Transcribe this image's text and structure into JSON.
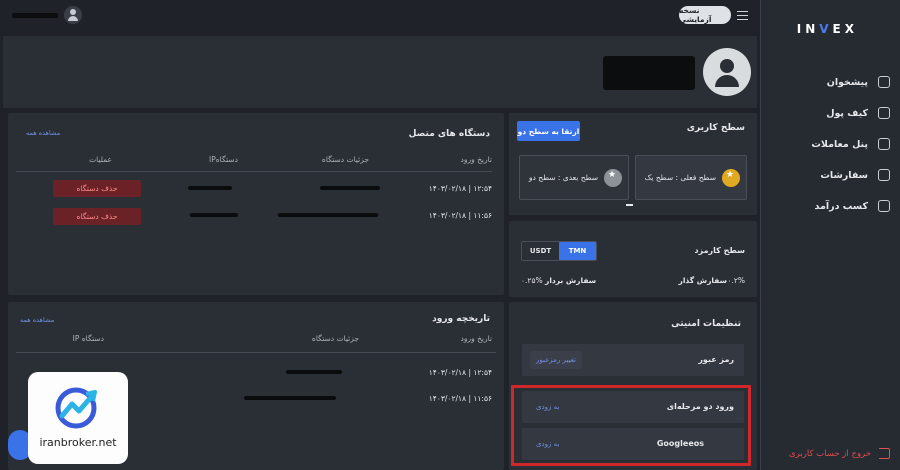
{
  "sidebar": {
    "logo": {
      "left": "IN",
      "mark": "V",
      "right": "EX"
    },
    "items": [
      {
        "label": "پیشخوان",
        "icon": "dashboard-icon"
      },
      {
        "label": "کیف پول",
        "icon": "wallet-icon"
      },
      {
        "label": "پنل معاملات",
        "icon": "trade-panel-icon"
      },
      {
        "label": "سفارشات",
        "icon": "orders-icon"
      },
      {
        "label": "کسب درآمد",
        "icon": "earn-icon"
      }
    ],
    "logout": "خروج از حساب کاربری"
  },
  "header": {
    "demo_badge": "نسخه آزمایشی"
  },
  "devices": {
    "title": "دستگاه های متصل",
    "view_all": "مشاهده همه",
    "columns": [
      "تاریخ ورود",
      "جزئیات دستگاه",
      "IPدستگاه",
      "عملیات"
    ],
    "rows": [
      {
        "date": "۱۴۰۳/۰۲/۱۸ | ۱۲:۵۴",
        "action": "حذف دستگاه"
      },
      {
        "date": "۱۴۰۳/۰۲/۱۸ | ۱۱:۵۶",
        "action": "حذف دستگاه"
      }
    ]
  },
  "history": {
    "title": "تاریخچه ورود",
    "view_all": "مشاهده همه",
    "columns": [
      "تاریخ ورود",
      "جزئیات دستگاه",
      "IP دستگاه"
    ],
    "rows": [
      {
        "date": "۱۴۰۳/۰۲/۱۸ | ۱۲:۵۴"
      },
      {
        "date": "۱۴۰۳/۰۲/۱۸ | ۱۱:۵۶"
      }
    ]
  },
  "level": {
    "title": "سطح کاربری",
    "upgrade_button": "ارتقا به سطح دو",
    "current": "سطح فعلی : سطح یک",
    "next": "سطح بعدی : سطح دو"
  },
  "fees": {
    "title": "سطح کارمزد",
    "tabs": [
      "TMN",
      "USDT"
    ],
    "maker_label": "سفارش گذار",
    "maker_value": "۰.۲%",
    "taker_label": "سفارش بردار",
    "taker_value": "۰.۲۵%"
  },
  "security": {
    "title": "تنظیمات امنیتی",
    "password_label": "رمز عبور",
    "password_button": "تغییر رمزعبور",
    "twofa_label": "ورود دو مرحله‌ای",
    "twofa_status": "به زودی",
    "google_label": "Googleeos",
    "google_status": "به زودی"
  },
  "watermark": {
    "text": "iranbroker.net"
  },
  "colors": {
    "accent": "#3a72e8",
    "danger": "#d1272a",
    "gold": "#e0a922"
  }
}
